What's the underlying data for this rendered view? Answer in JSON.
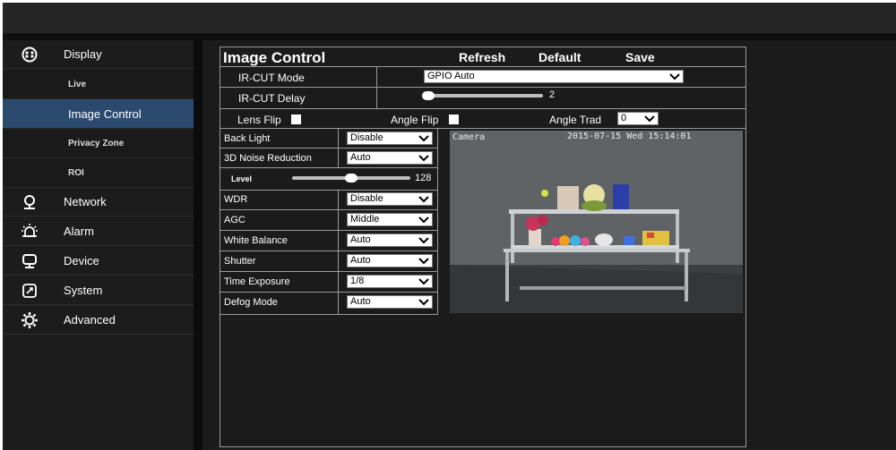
{
  "sidebar": {
    "items": [
      {
        "label": "Display",
        "icon": "display-icon"
      },
      {
        "label": "Network",
        "icon": "network-icon"
      },
      {
        "label": "Alarm",
        "icon": "alarm-icon"
      },
      {
        "label": "Device",
        "icon": "device-icon"
      },
      {
        "label": "System",
        "icon": "system-icon"
      },
      {
        "label": "Advanced",
        "icon": "advanced-icon"
      }
    ],
    "display_sub": [
      {
        "label": "Live"
      },
      {
        "label": "Image Control"
      },
      {
        "label": "Privacy Zone"
      },
      {
        "label": "ROI"
      }
    ]
  },
  "panel": {
    "title": "Image Control",
    "refresh": "Refresh",
    "default": "Default",
    "save": "Save",
    "ircut_mode": {
      "label": "IR-CUT Mode",
      "value": "GPIO Auto"
    },
    "ircut_delay": {
      "label": "IR-CUT Delay",
      "value": "2",
      "level": 0.0
    },
    "lens_flip": {
      "label": "Lens Flip"
    },
    "angle_flip": {
      "label": "Angle Flip"
    },
    "angle_trad": {
      "label": "Angle Trad",
      "value": "0"
    },
    "settings": [
      {
        "label": "Back Light",
        "value": "Disable"
      },
      {
        "label": "3D Noise Reduction",
        "value": "Auto"
      },
      {
        "label": "WDR",
        "value": "Disable"
      },
      {
        "label": "AGC",
        "value": "Middle"
      },
      {
        "label": "White Balance",
        "value": "Auto"
      },
      {
        "label": "Shutter",
        "value": "Auto"
      },
      {
        "label": "Time Exposure",
        "value": "1/8"
      },
      {
        "label": "Defog Mode",
        "value": "Auto"
      }
    ],
    "level": {
      "label": "Level",
      "value": "128",
      "fraction": 0.5
    }
  },
  "video": {
    "camera_label": "Camera",
    "timestamp": "2015-07-15 Wed 15:14:01"
  },
  "colors": {
    "accent": "#2b4a6e",
    "sidebar_bg": "#1c1c1c",
    "panel_border": "#9a9a9a"
  }
}
